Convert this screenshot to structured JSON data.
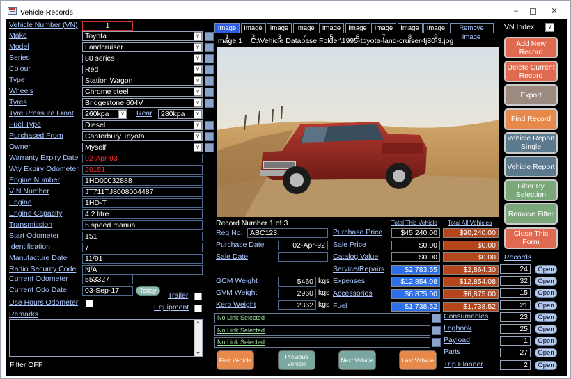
{
  "window": {
    "title": "Vehicle Records"
  },
  "fields": [
    {
      "label": "Make",
      "value": "Toyota"
    },
    {
      "label": "Model",
      "value": "Landcruiser"
    },
    {
      "label": "Series",
      "value": "80 series"
    },
    {
      "label": "Colour",
      "value": "Red"
    },
    {
      "label": "Type",
      "value": "Station Wagon"
    },
    {
      "label": "Wheels",
      "value": "Chrome steel"
    },
    {
      "label": "Tyres",
      "value": "Bridgestone 604V"
    }
  ],
  "vehicle_number": {
    "label": "Vehicle Number (VN)",
    "value": "1"
  },
  "tyre_pressure": {
    "label": "Tyre Pressure Front",
    "front": "260kpa",
    "rear_label": "Rear",
    "rear": "280kpa"
  },
  "fields2": [
    {
      "label": "Fuel Type",
      "value": "Diesel"
    },
    {
      "label": "Purchased From",
      "value": "Canterbury Toyota"
    },
    {
      "label": "Owner",
      "value": "Myself"
    }
  ],
  "fields3": [
    {
      "label": "Warranty Expiry Date",
      "value": "02-Apr-93"
    },
    {
      "label": "Wty Expiry Odometer",
      "value": "20151"
    },
    {
      "label": "Engine Number",
      "value": "1HD00032888"
    },
    {
      "label": "VIN Number",
      "value": "JT711TJ8008004487"
    },
    {
      "label": "Engine",
      "value": "1HD-T"
    },
    {
      "label": "Engine Capacity",
      "value": "4.2 litre"
    },
    {
      "label": "Transmission",
      "value": "5 speed manual"
    },
    {
      "label": "Start Odometer",
      "value": "151"
    },
    {
      "label": "Identification",
      "value": "7"
    },
    {
      "label": "Manufacture Date",
      "value": "11/91"
    },
    {
      "label": "Radio Security Code",
      "value": "N/A"
    }
  ],
  "current_odometer": {
    "label": "Current Odometer",
    "value": "553327"
  },
  "current_odo_date": {
    "label": "Current Odo Date",
    "value": "03-Sep-17",
    "today": "Today"
  },
  "trailer": "Trailer",
  "equipment": "Equipment",
  "use_hours": "Use Hours Odometer",
  "remarks": "Remarks",
  "filter_status": "Filter OFF",
  "image_tabs": [
    "Image 1",
    "Image 2",
    "Image 3",
    "Image 4",
    "Image 5",
    "Image 6",
    "Image 7",
    "Image 8",
    "Image 9"
  ],
  "remove_image": "Remove Image",
  "image_caption": "Image 1",
  "image_path": "C:\\Vehicle Database Folder\\1995-toyota-land-cruiser-fj80-3.jpg",
  "vn_index": "VN Index",
  "record_number": "Record Number 1 of 3",
  "reg_no": {
    "label": "Reg No.",
    "value": "ABC123"
  },
  "purchase_date": {
    "label": "Purchase Date",
    "value": "02-Apr-92"
  },
  "sale_date": {
    "label": "Sale Date",
    "value": ""
  },
  "weights": [
    {
      "label": "GCM Weight",
      "value": "5460",
      "unit": "kgs"
    },
    {
      "label": "GVM Weight",
      "value": "2960",
      "unit": "kgs"
    },
    {
      "label": "Kerb Weight",
      "value": "2362",
      "unit": "kgs"
    }
  ],
  "totals_headers": {
    "this": "Total This Vehicle",
    "all": "Total All Vehicles"
  },
  "money_rows": [
    {
      "label": "Purchase Price",
      "this": "$45,240.00",
      "all": "$90,240.00",
      "blue": false
    },
    {
      "label": "Sale Price",
      "this": "$0.00",
      "all": "$0.00",
      "blue": false
    },
    {
      "label": "Catalog Value",
      "this": "$0.00",
      "all": "$0.00",
      "blue": false
    },
    {
      "label": "Service/Repairs",
      "this": "$2,783.55",
      "all": "$2,864.30",
      "blue": true
    },
    {
      "label": "Expenses",
      "this": "$12,854.08",
      "all": "$12,854.08",
      "blue": true
    },
    {
      "label": "Accessories",
      "this": "$6,875.00",
      "all": "$6,875.00",
      "blue": true
    },
    {
      "label": "Fuel",
      "this": "$1,738.52",
      "all": "$1,738.52",
      "blue": true
    }
  ],
  "records_label": "Records",
  "records": [
    {
      "label": "",
      "count": "24"
    },
    {
      "label": "",
      "count": "32"
    },
    {
      "label": "",
      "count": "15"
    },
    {
      "label": "",
      "count": "21"
    },
    {
      "label": "Consumables",
      "count": "23"
    },
    {
      "label": "Logbook",
      "count": "25"
    },
    {
      "label": "Payload",
      "count": "1"
    },
    {
      "label": "Parts",
      "count": "27"
    },
    {
      "label": "Trip Planner",
      "count": "2"
    }
  ],
  "open_label": "Open",
  "links": [
    "No Link Selected",
    "No Link Selected",
    "No Link Selected"
  ],
  "nav": [
    "First Vehicle",
    "Previous Vehicle",
    "Next Vehicle",
    "Last Vehicle"
  ],
  "right_buttons": [
    {
      "label": "Add New Record",
      "color": "#e06a50"
    },
    {
      "label": "Delete Current Record",
      "color": "#e06a50"
    },
    {
      "label": "Export",
      "color": "#9c8a80"
    },
    {
      "label": "Find Record",
      "color": "#e8894c"
    },
    {
      "label": "Vehicle Report Single",
      "color": "#5c7a8e"
    },
    {
      "label": "Vehicle Report",
      "color": "#5c7a8e"
    },
    {
      "label": "Filter By Selection",
      "color": "#7aa87a"
    },
    {
      "label": "Remove Filter",
      "color": "#7aa87a"
    },
    {
      "label": "Close This Form",
      "color": "#e06a50"
    }
  ]
}
